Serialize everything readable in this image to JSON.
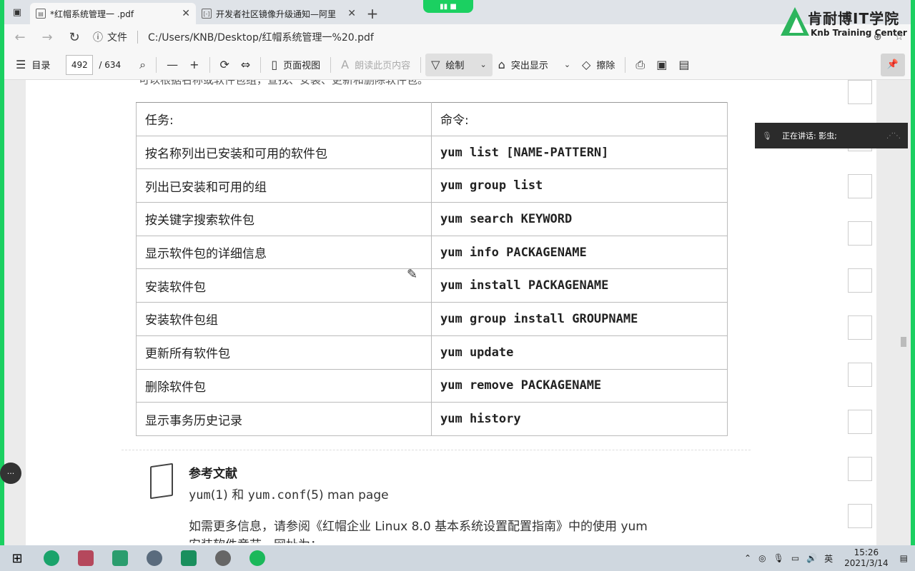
{
  "browser": {
    "tabs": [
      {
        "title": "*红帽系统管理一 .pdf",
        "active": true
      },
      {
        "title": "开发者社区镜像升级通知—阿里",
        "active": false
      }
    ],
    "address_label": "文件",
    "url": "C:/Users/KNB/Desktop/红帽系统管理一%20.pdf"
  },
  "logo": {
    "cn": "肯耐博IT学院",
    "en": "Knb Training Center"
  },
  "toolbar": {
    "toc_label": "目录",
    "page_current": "492",
    "page_total": "/ 634",
    "page_view_label": "页面视图",
    "read_aloud_label": "朗读此页内容",
    "draw_label": "绘制",
    "highlight_label": "突出显示",
    "erase_label": "擦除"
  },
  "document": {
    "cut_text": "可以根据名称或软件包组，查找、安装、更新和删除软件包。",
    "table": {
      "headers": [
        "任务:",
        "命令:"
      ],
      "rows": [
        [
          "按名称列出已安装和可用的软件包",
          "yum list [NAME-PATTERN]"
        ],
        [
          "列出已安装和可用的组",
          "yum group list"
        ],
        [
          "按关键字搜索软件包",
          "yum search KEYWORD"
        ],
        [
          "显示软件包的详细信息",
          "yum info PACKAGENAME"
        ],
        [
          "安装软件包",
          "yum install PACKAGENAME"
        ],
        [
          "安装软件包组",
          "yum group install GROUPNAME"
        ],
        [
          "更新所有软件包",
          "yum update"
        ],
        [
          "删除软件包",
          "yum remove PACKAGENAME"
        ],
        [
          "显示事务历史记录",
          "yum history"
        ]
      ]
    },
    "reference": {
      "title": "参考文献",
      "sub_pre": "yum",
      "sub_mid1": "(1) 和 ",
      "sub_mono2": "yum.conf",
      "sub_mid2": "(5) man page",
      "text1": "如需更多信息，请参阅《红帽企业 Linux 8.0 基本系统设置配置指南》中的使用 yum",
      "text2": "安装软件章节，网址为："
    }
  },
  "toast": {
    "text": "正在讲话: 影虫;"
  },
  "taskbar": {
    "lang": "英",
    "time": "15:26",
    "date": "2021/3/14"
  }
}
